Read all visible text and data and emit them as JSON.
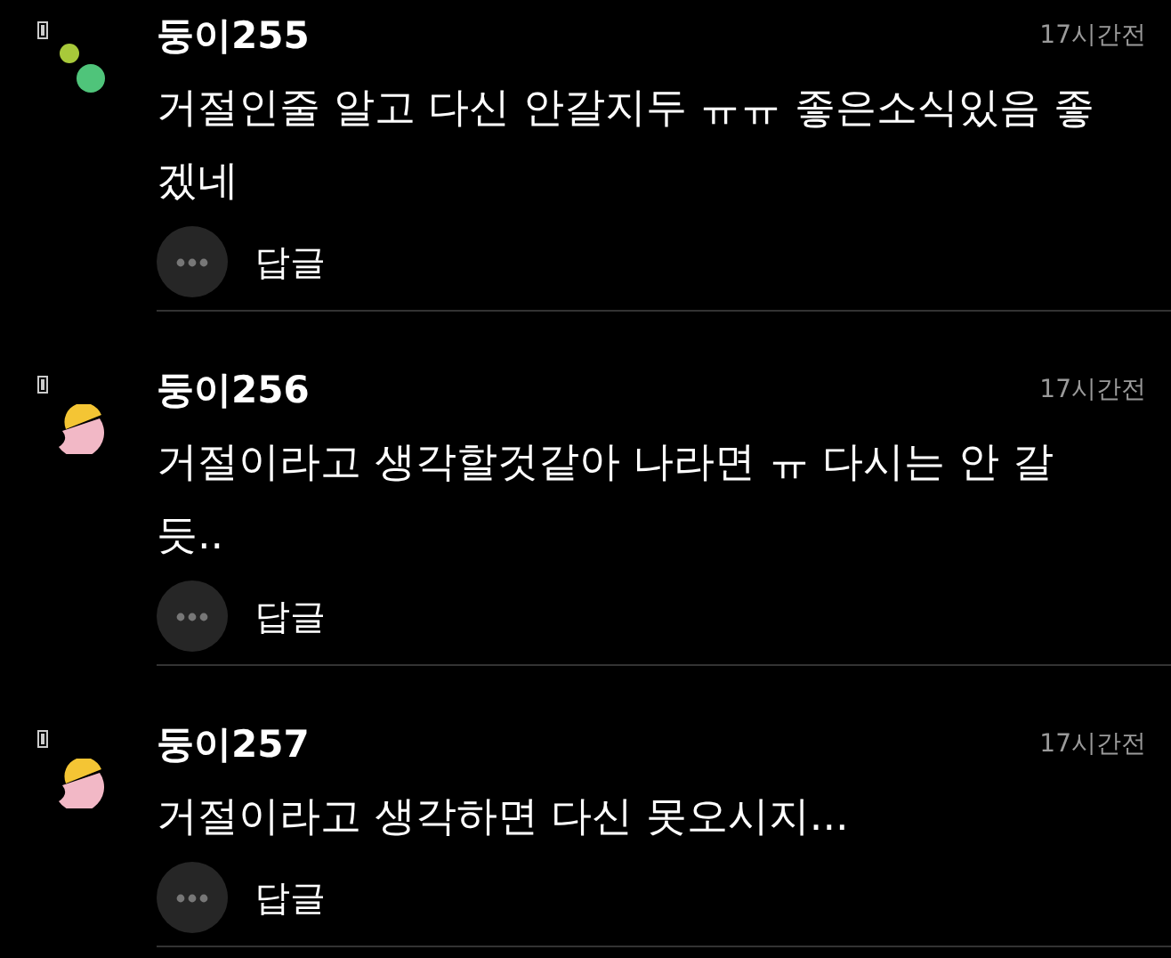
{
  "comments": [
    {
      "kind": "dots",
      "name": "둥이255",
      "time": "17시간전",
      "body": "거절인줄 알고 다신 안갈지두 ㅠㅠ 좋은소식있음 좋겠네",
      "reply": "답글"
    },
    {
      "kind": "half",
      "name": "둥이256",
      "time": "17시간전",
      "body": "거절이라고 생각할것같아 나라면 ㅠ 다시는 안 갈듯..",
      "reply": "답글"
    },
    {
      "kind": "half",
      "name": "둥이257",
      "time": "17시간전",
      "body": "거절이라고 생각하면 다신 못오시지...",
      "reply": "답글"
    }
  ]
}
